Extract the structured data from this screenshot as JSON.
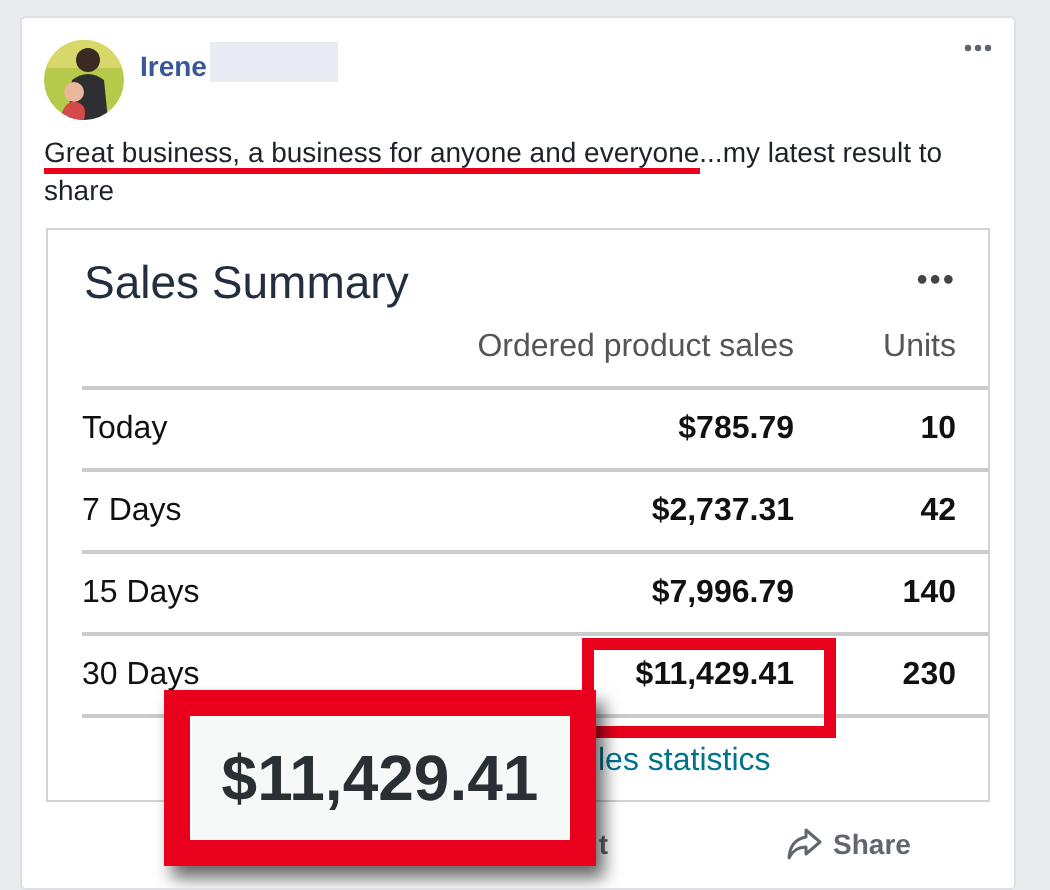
{
  "post": {
    "author": "Irene",
    "text_underlined": "Great business, a business for anyone and everyone",
    "text_rest": "...my latest result to share"
  },
  "screenshot": {
    "title": "Sales Summary",
    "menu": "•••",
    "columns": [
      "Ordered product sales",
      "Units"
    ],
    "rows": [
      {
        "period": "Today",
        "sales": "$785.79",
        "units": "10",
        "highlighted": false
      },
      {
        "period": "7 Days",
        "sales": "$2,737.31",
        "units": "42",
        "highlighted": false
      },
      {
        "period": "15 Days",
        "sales": "$7,996.79",
        "units": "140",
        "highlighted": false
      },
      {
        "period": "30 Days",
        "sales": "$11,429.41",
        "units": "230",
        "highlighted": true
      }
    ],
    "link": "les statistics"
  },
  "zoom_callout": "$11,429.41",
  "actions": [
    {
      "kind": "comment",
      "label": "t"
    },
    {
      "kind": "share",
      "label": "Share"
    }
  ]
}
